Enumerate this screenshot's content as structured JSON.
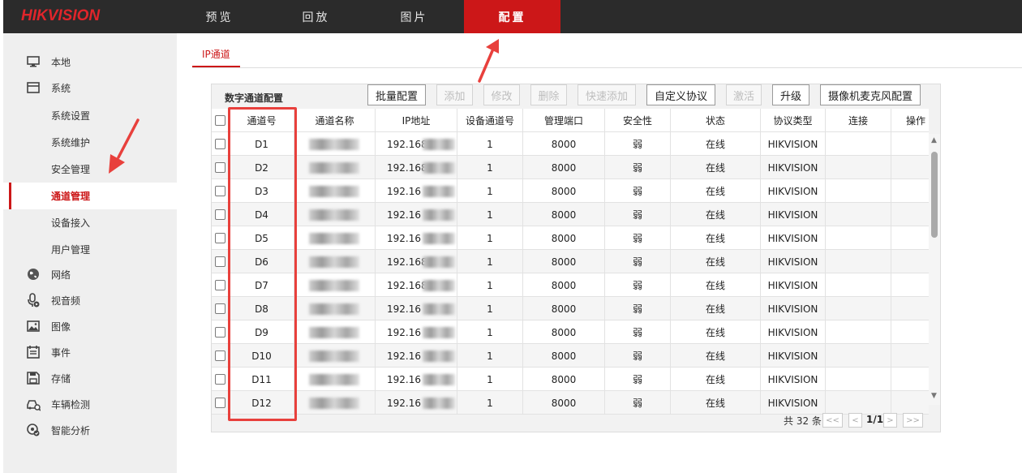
{
  "brand": "HIKVISION",
  "nav": {
    "tabs": [
      "预览",
      "回放",
      "图片",
      "配置"
    ],
    "active_index": 3
  },
  "sidebar": {
    "items": [
      {
        "label": "本地",
        "icon": "monitor-icon",
        "sub": false
      },
      {
        "label": "系统",
        "icon": "window-icon",
        "sub": false
      },
      {
        "label": "系统设置",
        "icon": "",
        "sub": true
      },
      {
        "label": "系统维护",
        "icon": "",
        "sub": true
      },
      {
        "label": "安全管理",
        "icon": "",
        "sub": true
      },
      {
        "label": "通道管理",
        "icon": "",
        "sub": true,
        "active": true
      },
      {
        "label": "设备接入",
        "icon": "",
        "sub": true
      },
      {
        "label": "用户管理",
        "icon": "",
        "sub": true
      },
      {
        "label": "网络",
        "icon": "globe-icon",
        "sub": false
      },
      {
        "label": "视音频",
        "icon": "microphone-icon",
        "sub": false
      },
      {
        "label": "图像",
        "icon": "image-icon",
        "sub": false
      },
      {
        "label": "事件",
        "icon": "calendar-icon",
        "sub": false
      },
      {
        "label": "存储",
        "icon": "save-icon",
        "sub": false
      },
      {
        "label": "车辆检测",
        "icon": "car-search-icon",
        "sub": false
      },
      {
        "label": "智能分析",
        "icon": "smart-analysis-icon",
        "sub": false
      }
    ]
  },
  "subtab": "IP通道",
  "panel": {
    "title": "数字通道配置",
    "buttons": [
      {
        "label": "批量配置",
        "enabled": true
      },
      {
        "label": "添加",
        "enabled": false
      },
      {
        "label": "修改",
        "enabled": false
      },
      {
        "label": "删除",
        "enabled": false
      },
      {
        "label": "快速添加",
        "enabled": false
      },
      {
        "label": "自定义协议",
        "enabled": true
      },
      {
        "label": "激活",
        "enabled": false
      },
      {
        "label": "升级",
        "enabled": true
      },
      {
        "label": "摄像机麦克风配置",
        "enabled": true
      }
    ]
  },
  "table": {
    "columns": [
      "通道号",
      "通道名称",
      "IP地址",
      "设备通道号",
      "管理端口",
      "安全性",
      "状态",
      "协议类型",
      "连接",
      "操作"
    ],
    "rows": [
      {
        "channel": "D1",
        "ip": "192.168",
        "dev_ch": "1",
        "port": "8000",
        "security": "弱",
        "status": "在线",
        "protocol": "HIKVISION"
      },
      {
        "channel": "D2",
        "ip": "192.168",
        "dev_ch": "1",
        "port": "8000",
        "security": "弱",
        "status": "在线",
        "protocol": "HIKVISION"
      },
      {
        "channel": "D3",
        "ip": "192.16",
        "dev_ch": "1",
        "port": "8000",
        "security": "弱",
        "status": "在线",
        "protocol": "HIKVISION"
      },
      {
        "channel": "D4",
        "ip": "192.16",
        "dev_ch": "1",
        "port": "8000",
        "security": "弱",
        "status": "在线",
        "protocol": "HIKVISION"
      },
      {
        "channel": "D5",
        "ip": "192.16",
        "dev_ch": "1",
        "port": "8000",
        "security": "弱",
        "status": "在线",
        "protocol": "HIKVISION"
      },
      {
        "channel": "D6",
        "ip": "192.168",
        "dev_ch": "1",
        "port": "8000",
        "security": "弱",
        "status": "在线",
        "protocol": "HIKVISION"
      },
      {
        "channel": "D7",
        "ip": "192.168",
        "dev_ch": "1",
        "port": "8000",
        "security": "弱",
        "status": "在线",
        "protocol": "HIKVISION"
      },
      {
        "channel": "D8",
        "ip": "192.16",
        "dev_ch": "1",
        "port": "8000",
        "security": "弱",
        "status": "在线",
        "protocol": "HIKVISION"
      },
      {
        "channel": "D9",
        "ip": "192.16",
        "dev_ch": "1",
        "port": "8000",
        "security": "弱",
        "status": "在线",
        "protocol": "HIKVISION"
      },
      {
        "channel": "D10",
        "ip": "192.16",
        "dev_ch": "1",
        "port": "8000",
        "security": "弱",
        "status": "在线",
        "protocol": "HIKVISION"
      },
      {
        "channel": "D11",
        "ip": "192.16",
        "dev_ch": "1",
        "port": "8000",
        "security": "弱",
        "status": "在线",
        "protocol": "HIKVISION"
      },
      {
        "channel": "D12",
        "ip": "192.16",
        "dev_ch": "1",
        "port": "8000",
        "security": "弱",
        "status": "在线",
        "protocol": "HIKVISION"
      }
    ]
  },
  "pagination": {
    "total": "共 32 条",
    "first": "<<",
    "prev": "<",
    "current": "1/1",
    "next": ">",
    "last": ">>"
  },
  "colors": {
    "accent": "#cc1718",
    "topbar": "#2b2b2b",
    "annotation": "#e8403c"
  }
}
